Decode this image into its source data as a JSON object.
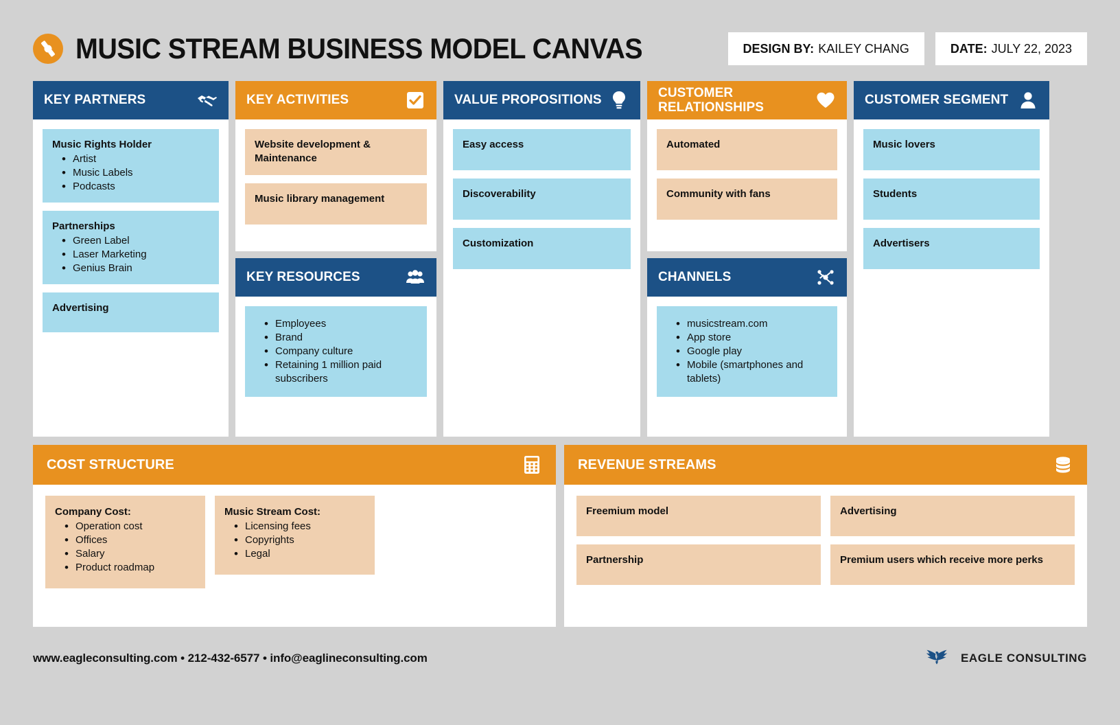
{
  "header": {
    "title": "MUSIC STREAM BUSINESS MODEL CANVAS",
    "logo_icon": "vinyl-disc-icon",
    "design_by_label": "DESIGN BY:",
    "design_by_value": "KAILEY CHANG",
    "date_label": "DATE:",
    "date_value": "JULY 22, 2023"
  },
  "colors": {
    "blue": "#1c5186",
    "orange": "#e8911f",
    "card_blue": "#a6dbec",
    "card_peach": "#f0d0b0",
    "background": "#d2d2d2",
    "panel": "#ffffff"
  },
  "blocks": {
    "key_partners": {
      "title": "KEY PARTNERS",
      "icon": "handshake-icon",
      "header_color": "blue",
      "cards": [
        {
          "style": "blue",
          "heading": "Music Rights Holder",
          "items": [
            "Artist",
            "Music Labels",
            "Podcasts"
          ]
        },
        {
          "style": "blue",
          "heading": "Partnerships",
          "items": [
            "Green Label",
            "Laser Marketing",
            "Genius Brain"
          ]
        },
        {
          "style": "blue",
          "heading": "Advertising",
          "items": []
        }
      ]
    },
    "key_activities": {
      "title": "KEY ACTIVITIES",
      "icon": "checkbox-icon",
      "header_color": "orange",
      "cards": [
        {
          "style": "peach",
          "heading": "Website development & Maintenance",
          "items": []
        },
        {
          "style": "peach",
          "heading": "Music library management",
          "items": []
        }
      ]
    },
    "key_resources": {
      "title": "KEY RESOURCES",
      "icon": "people-group-icon",
      "header_color": "blue",
      "cards": [
        {
          "style": "blue",
          "heading": "",
          "items": [
            "Employees",
            "Brand",
            "Company culture",
            "Retaining 1 million paid subscribers"
          ]
        }
      ]
    },
    "value_propositions": {
      "title": "VALUE PROPOSITIONS",
      "icon": "lightbulb-icon",
      "header_color": "blue",
      "cards": [
        {
          "style": "blue",
          "heading": "Easy access",
          "items": []
        },
        {
          "style": "blue",
          "heading": "Discoverability",
          "items": []
        },
        {
          "style": "blue",
          "heading": "Customization",
          "items": []
        }
      ]
    },
    "customer_relationships": {
      "title": "CUSTOMER RELATIONSHIPS",
      "icon": "heart-icon",
      "header_color": "orange",
      "cards": [
        {
          "style": "peach",
          "heading": "Automated",
          "items": []
        },
        {
          "style": "peach",
          "heading": "Community with fans",
          "items": []
        }
      ]
    },
    "channels": {
      "title": "CHANNELS",
      "icon": "network-nodes-icon",
      "header_color": "blue",
      "cards": [
        {
          "style": "blue",
          "heading": "",
          "items": [
            "musicstream.com",
            "App store",
            "Google play",
            "Mobile (smartphones and tablets)"
          ]
        }
      ]
    },
    "customer_segment": {
      "title": "CUSTOMER SEGMENT",
      "icon": "person-icon",
      "header_color": "blue",
      "cards": [
        {
          "style": "blue",
          "heading": "Music lovers",
          "items": []
        },
        {
          "style": "blue",
          "heading": "Students",
          "items": []
        },
        {
          "style": "blue",
          "heading": "Advertisers",
          "items": []
        }
      ]
    },
    "cost_structure": {
      "title": "COST STRUCTURE",
      "icon": "calculator-icon",
      "header_color": "orange",
      "cards": [
        {
          "style": "peach",
          "heading": "Company Cost:",
          "items": [
            "Operation cost",
            "Offices",
            "Salary",
            "Product roadmap"
          ]
        },
        {
          "style": "peach",
          "heading": "Music Stream Cost:",
          "items": [
            "Licensing fees",
            "Copyrights",
            "Legal"
          ]
        }
      ]
    },
    "revenue_streams": {
      "title": "REVENUE STREAMS",
      "icon": "coins-stack-icon",
      "header_color": "orange",
      "cards": [
        {
          "style": "peach",
          "heading": "Freemium model",
          "items": []
        },
        {
          "style": "peach",
          "heading": "Advertising",
          "items": []
        },
        {
          "style": "peach",
          "heading": "Partnership",
          "items": []
        },
        {
          "style": "peach",
          "heading": "Premium users which receive more perks",
          "items": []
        }
      ]
    }
  },
  "footer": {
    "contact": "www.eagleconsulting.com • 212-432-6577 • info@eaglineconsulting.com",
    "brand_name": "EAGLE CONSULTING",
    "brand_icon": "eagle-logo-icon"
  }
}
